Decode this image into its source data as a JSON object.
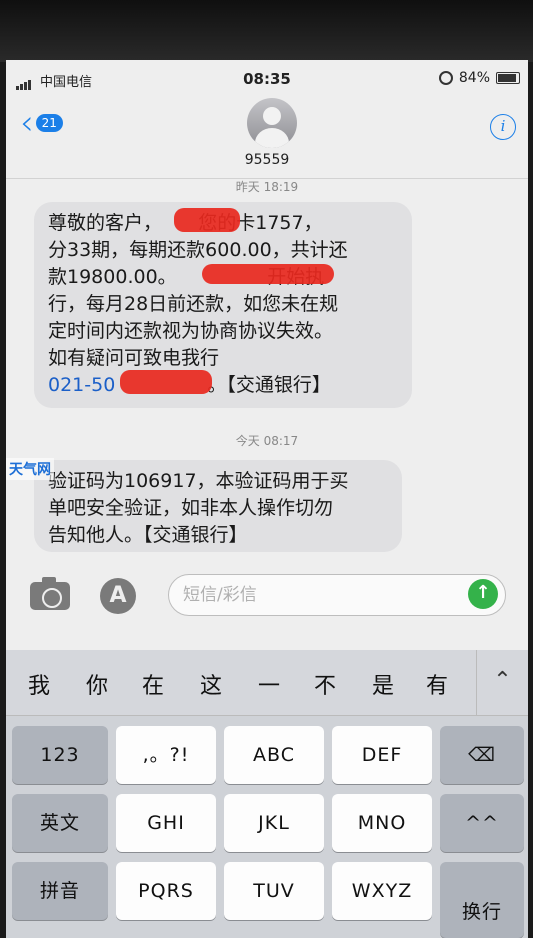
{
  "status_bar": {
    "carrier": "中国电信",
    "time": "08:35",
    "battery": "84%"
  },
  "header": {
    "back_badge": "21",
    "contact": "95559"
  },
  "messages": [
    {
      "timestamp": "昨天 18:19",
      "lines": [
        "尊敬的客户，      您的卡1757，",
        "分33期，每期还款600.00，共计还",
        "款19800.00。               开始执",
        "行，每月28日前还款，如您未在规",
        "定时间内还款视为协商协议失效。",
        "如有疑问可致电我行"
      ],
      "link_text": "021-50",
      "suffix": "。【交通银行】"
    },
    {
      "timestamp": "今天 08:17",
      "lines": [
        "验证码为106917，本验证码用于买",
        "单吧安全验证，如非本人操作切勿",
        "告知他人。【交通银行】"
      ]
    }
  ],
  "composer": {
    "placeholder": "短信/彩信"
  },
  "keyboard": {
    "candidates": [
      "我",
      "你",
      "在",
      "这",
      "一",
      "不",
      "是",
      "有"
    ],
    "rows": [
      [
        "123",
        ",。?!",
        "ABC",
        "DEF",
        "⌫"
      ],
      [
        "英文",
        "GHI",
        "JKL",
        "MNO",
        "^^"
      ],
      [
        "拼音",
        "PQRS",
        "TUV",
        "WXYZ",
        "换行"
      ]
    ]
  },
  "watermark": "天气网"
}
